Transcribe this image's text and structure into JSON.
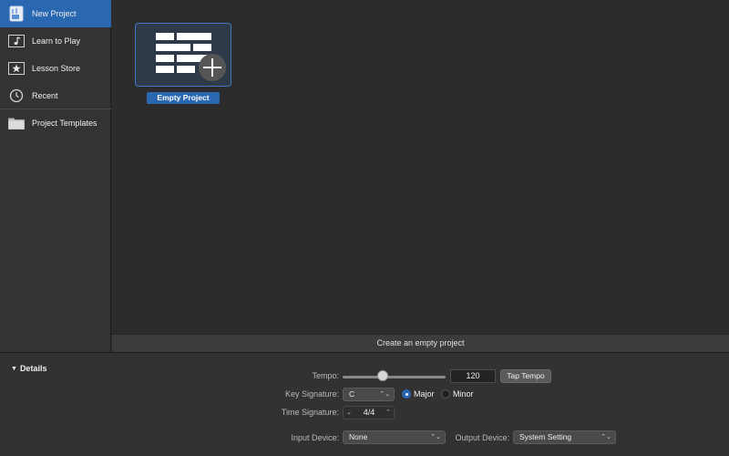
{
  "sidebar": {
    "items": [
      {
        "label": "New Project",
        "icon": "new-project-icon",
        "selected": true
      },
      {
        "label": "Learn to Play",
        "icon": "music-note-icon",
        "selected": false
      },
      {
        "label": "Lesson Store",
        "icon": "star-icon",
        "selected": false
      },
      {
        "label": "Recent",
        "icon": "clock-icon",
        "selected": false
      },
      {
        "label": "Project Templates",
        "icon": "folder-icon",
        "selected": false
      }
    ]
  },
  "main": {
    "template": {
      "label": "Empty Project",
      "icon": "empty-project-icon"
    },
    "description": "Create an empty project"
  },
  "details": {
    "toggle_label": "Details",
    "tempo": {
      "label": "Tempo:",
      "value": "120",
      "tap_label": "Tap Tempo",
      "slider_position": 0.39
    },
    "key_signature": {
      "label": "Key Signature:",
      "value": "C",
      "mode_major": "Major",
      "mode_minor": "Minor",
      "selected_mode": "Major"
    },
    "time_signature": {
      "label": "Time Signature:",
      "value": "4/4"
    },
    "input_device": {
      "label": "Input Device:",
      "value": "None"
    },
    "output_device": {
      "label": "Output Device:",
      "value": "System Setting"
    }
  },
  "colors": {
    "accent": "#2a67b1",
    "background": "#2c2c2c",
    "sidebar": "#333333"
  }
}
